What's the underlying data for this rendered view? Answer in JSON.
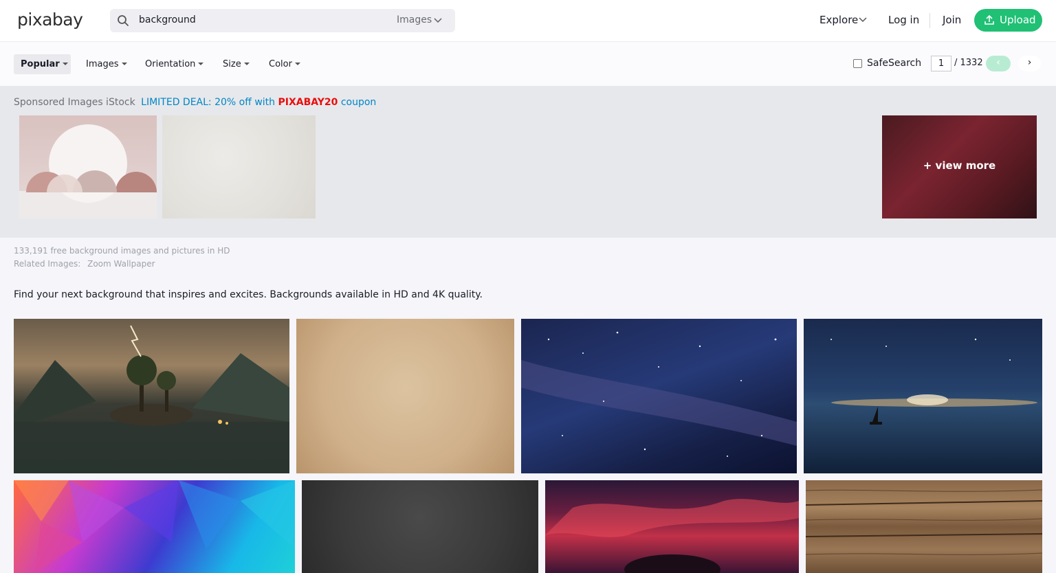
{
  "header": {
    "logo": "pixabay",
    "search_value": "background",
    "search_type": "Images",
    "explore": "Explore",
    "login": "Log in",
    "join": "Join",
    "upload": "Upload"
  },
  "filters": {
    "popular": "Popular",
    "images": "Images",
    "orientation": "Orientation",
    "size": "Size",
    "color": "Color",
    "safesearch": "SafeSearch",
    "page_current": "1",
    "page_total": "/ 1332",
    "prev": "‹",
    "next": "›"
  },
  "sponsored": {
    "label": "Sponsored Images iStock",
    "deal_prefix": "LIMITED DEAL: 20% off with",
    "coupon": "PIXABAY20",
    "deal_suffix": "coupon",
    "view_more": "+ view more"
  },
  "results": {
    "count_text": "133,191 free background images and pictures in HD",
    "related_label": "Related Images:",
    "related_items": [
      "Zoom Wallpaper"
    ],
    "tagline": "Find your next background that inspires and excites. Backgrounds available in HD and 4K quality."
  },
  "colors": {
    "accent": "#20c075",
    "link": "#0085c7",
    "coupon": "#e80e0e"
  },
  "images": [
    "lake-mountain-storm",
    "paper-texture",
    "milky-way",
    "night-sea-sailboat",
    "polygon-colorful",
    "chalkboard",
    "red-sky-tree",
    "wood-planks"
  ]
}
